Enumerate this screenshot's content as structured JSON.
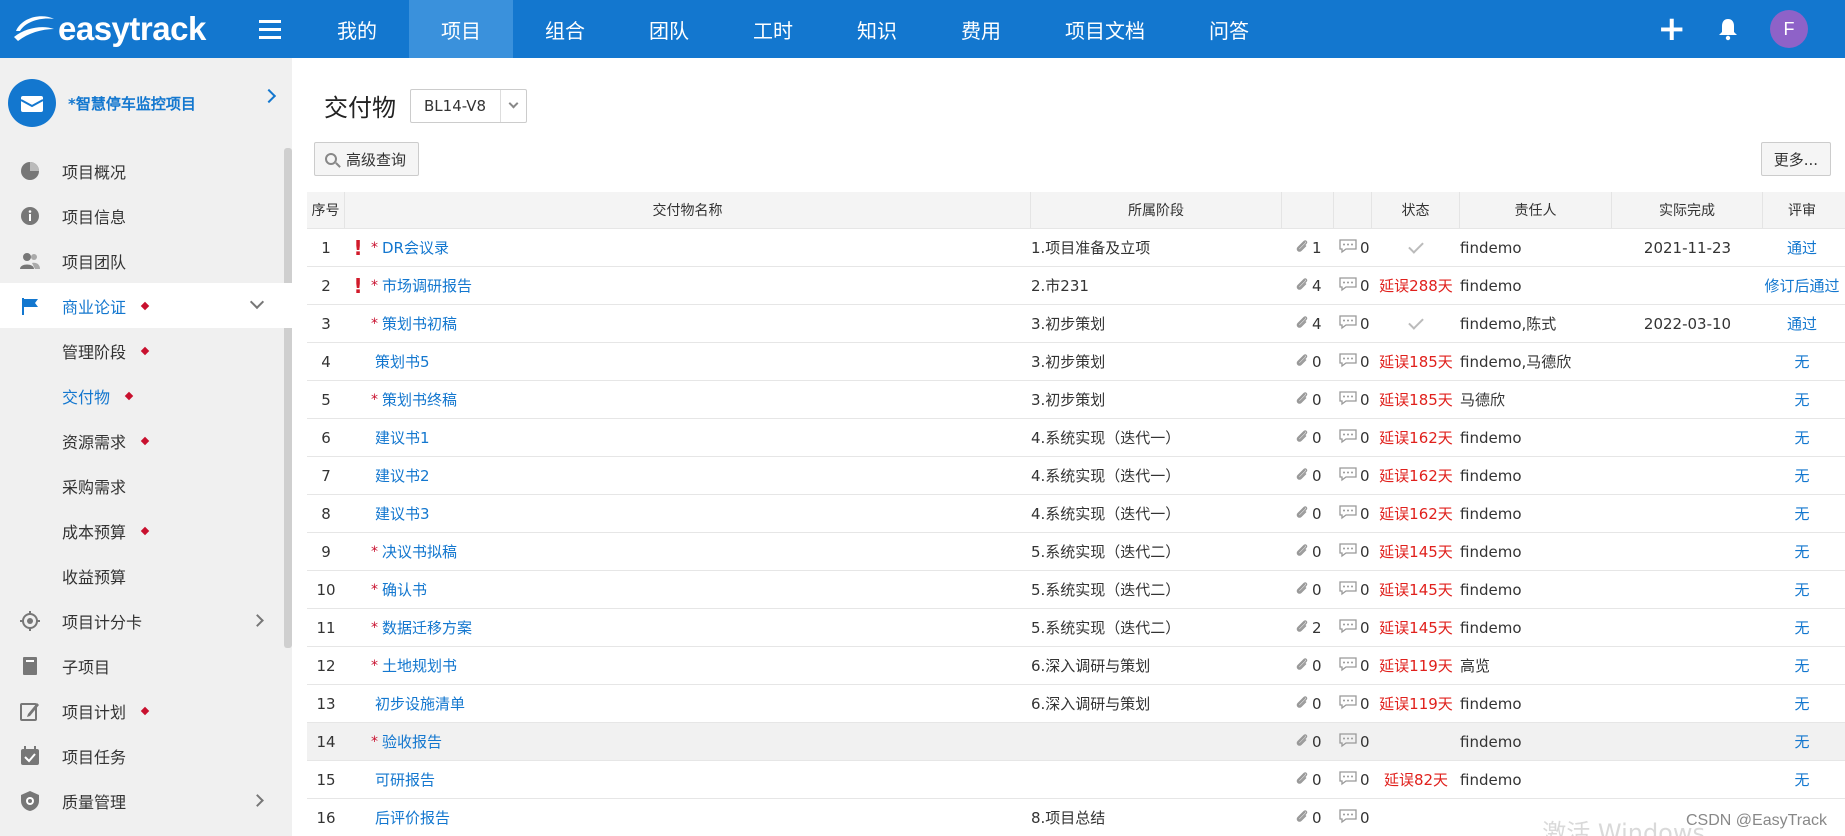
{
  "header": {
    "logo_text": "easytrack",
    "nav": [
      "我的",
      "项目",
      "组合",
      "团队",
      "工时",
      "知识",
      "费用",
      "项目文档",
      "问答"
    ],
    "active_nav": 1,
    "avatar_letter": "F",
    "plus_label": "+"
  },
  "sidebar": {
    "project_name": "*智慧停车监控项目",
    "items": [
      {
        "label": "项目概况",
        "icon": "pie-chart-icon"
      },
      {
        "label": "项目信息",
        "icon": "info-icon"
      },
      {
        "label": "项目团队",
        "icon": "team-icon"
      },
      {
        "label": "商业论证",
        "icon": "flag-icon"
      },
      {
        "label": "管理阶段"
      },
      {
        "label": "交付物"
      },
      {
        "label": "资源需求"
      },
      {
        "label": "采购需求"
      },
      {
        "label": "成本预算"
      },
      {
        "label": "收益预算"
      },
      {
        "label": "项目计分卡",
        "icon": "target-icon"
      },
      {
        "label": "子项目",
        "icon": "book-icon"
      },
      {
        "label": "项目计划",
        "icon": "edit-icon"
      },
      {
        "label": "项目任务",
        "icon": "calendar-check-icon"
      },
      {
        "label": "质量管理",
        "icon": "shield-icon"
      }
    ]
  },
  "main": {
    "title": "交付物",
    "version": "BL14-V8",
    "search_label": "高级查询",
    "more_label": "更多...",
    "columns": {
      "no": "序号",
      "name": "交付物名称",
      "phase": "所属阶段",
      "status": "状态",
      "owner": "责任人",
      "done": "实际完成",
      "review": "评审"
    },
    "rows": [
      {
        "no": "1",
        "flag": "!",
        "req": "*",
        "name": "DR会议录",
        "phase": "1.项目准备及立项",
        "att": "1",
        "cmt": "0",
        "status": "",
        "owner": "findemo",
        "done": "2021-11-23",
        "review": "通过"
      },
      {
        "no": "2",
        "flag": "!",
        "req": "*",
        "name": "市场调研报告",
        "phase": "2.市231",
        "att": "4",
        "cmt": "0",
        "status": "延误288天",
        "owner": "findemo",
        "done": "",
        "review": "修订后通过"
      },
      {
        "no": "3",
        "flag": "",
        "req": "*",
        "name": "策划书初稿",
        "phase": "3.初步策划",
        "att": "4",
        "cmt": "0",
        "status": "",
        "owner": "findemo,陈式",
        "done": "2022-03-10",
        "review": "通过"
      },
      {
        "no": "4",
        "flag": "",
        "req": "",
        "name": "策划书5",
        "phase": "3.初步策划",
        "att": "0",
        "cmt": "0",
        "status": "延误185天",
        "owner": "findemo,马德欣",
        "done": "",
        "review": "无"
      },
      {
        "no": "5",
        "flag": "",
        "req": "*",
        "name": "策划书终稿",
        "phase": "3.初步策划",
        "att": "0",
        "cmt": "0",
        "status": "延误185天",
        "owner": "马德欣",
        "done": "",
        "review": "无"
      },
      {
        "no": "6",
        "flag": "",
        "req": "",
        "name": "建议书1",
        "phase": "4.系统实现（迭代一）",
        "att": "0",
        "cmt": "0",
        "status": "延误162天",
        "owner": "findemo",
        "done": "",
        "review": "无"
      },
      {
        "no": "7",
        "flag": "",
        "req": "",
        "name": "建议书2",
        "phase": "4.系统实现（迭代一）",
        "att": "0",
        "cmt": "0",
        "status": "延误162天",
        "owner": "findemo",
        "done": "",
        "review": "无"
      },
      {
        "no": "8",
        "flag": "",
        "req": "",
        "name": "建议书3",
        "phase": "4.系统实现（迭代一）",
        "att": "0",
        "cmt": "0",
        "status": "延误162天",
        "owner": "findemo",
        "done": "",
        "review": "无"
      },
      {
        "no": "9",
        "flag": "",
        "req": "*",
        "name": "决议书拟稿",
        "phase": "5.系统实现（迭代二）",
        "att": "0",
        "cmt": "0",
        "status": "延误145天",
        "owner": "findemo",
        "done": "",
        "review": "无"
      },
      {
        "no": "10",
        "flag": "",
        "req": "*",
        "name": "确认书",
        "phase": "5.系统实现（迭代二）",
        "att": "0",
        "cmt": "0",
        "status": "延误145天",
        "owner": "findemo",
        "done": "",
        "review": "无"
      },
      {
        "no": "11",
        "flag": "",
        "req": "*",
        "name": "数据迁移方案",
        "phase": "5.系统实现（迭代二）",
        "att": "2",
        "cmt": "0",
        "status": "延误145天",
        "owner": "findemo",
        "done": "",
        "review": "无"
      },
      {
        "no": "12",
        "flag": "",
        "req": "*",
        "name": "土地规划书",
        "phase": "6.深入调研与策划",
        "att": "0",
        "cmt": "0",
        "status": "延误119天",
        "owner": "高览",
        "done": "",
        "review": "无"
      },
      {
        "no": "13",
        "flag": "",
        "req": "",
        "name": "初步设施清单",
        "phase": "6.深入调研与策划",
        "att": "0",
        "cmt": "0",
        "status": "延误119天",
        "owner": "findemo",
        "done": "",
        "review": "无"
      },
      {
        "no": "14",
        "flag": "",
        "req": "*",
        "name": "验收报告",
        "phase": "",
        "att": "0",
        "cmt": "0",
        "status": "",
        "owner": "findemo",
        "done": "",
        "review": "无"
      },
      {
        "no": "15",
        "flag": "",
        "req": "",
        "name": "可研报告",
        "phase": "",
        "att": "0",
        "cmt": "0",
        "status": "延误82天",
        "owner": "findemo",
        "done": "",
        "review": "无"
      },
      {
        "no": "16",
        "flag": "",
        "req": "",
        "name": "后评价报告",
        "phase": "8.项目总结",
        "att": "0",
        "cmt": "0",
        "status": "",
        "owner": "",
        "done": "",
        "review": ""
      }
    ]
  },
  "watermark": "CSDN @EasyTrack",
  "colors": {
    "brand": "#1377cf",
    "late": "#e0201c",
    "required": "#c8102e"
  }
}
